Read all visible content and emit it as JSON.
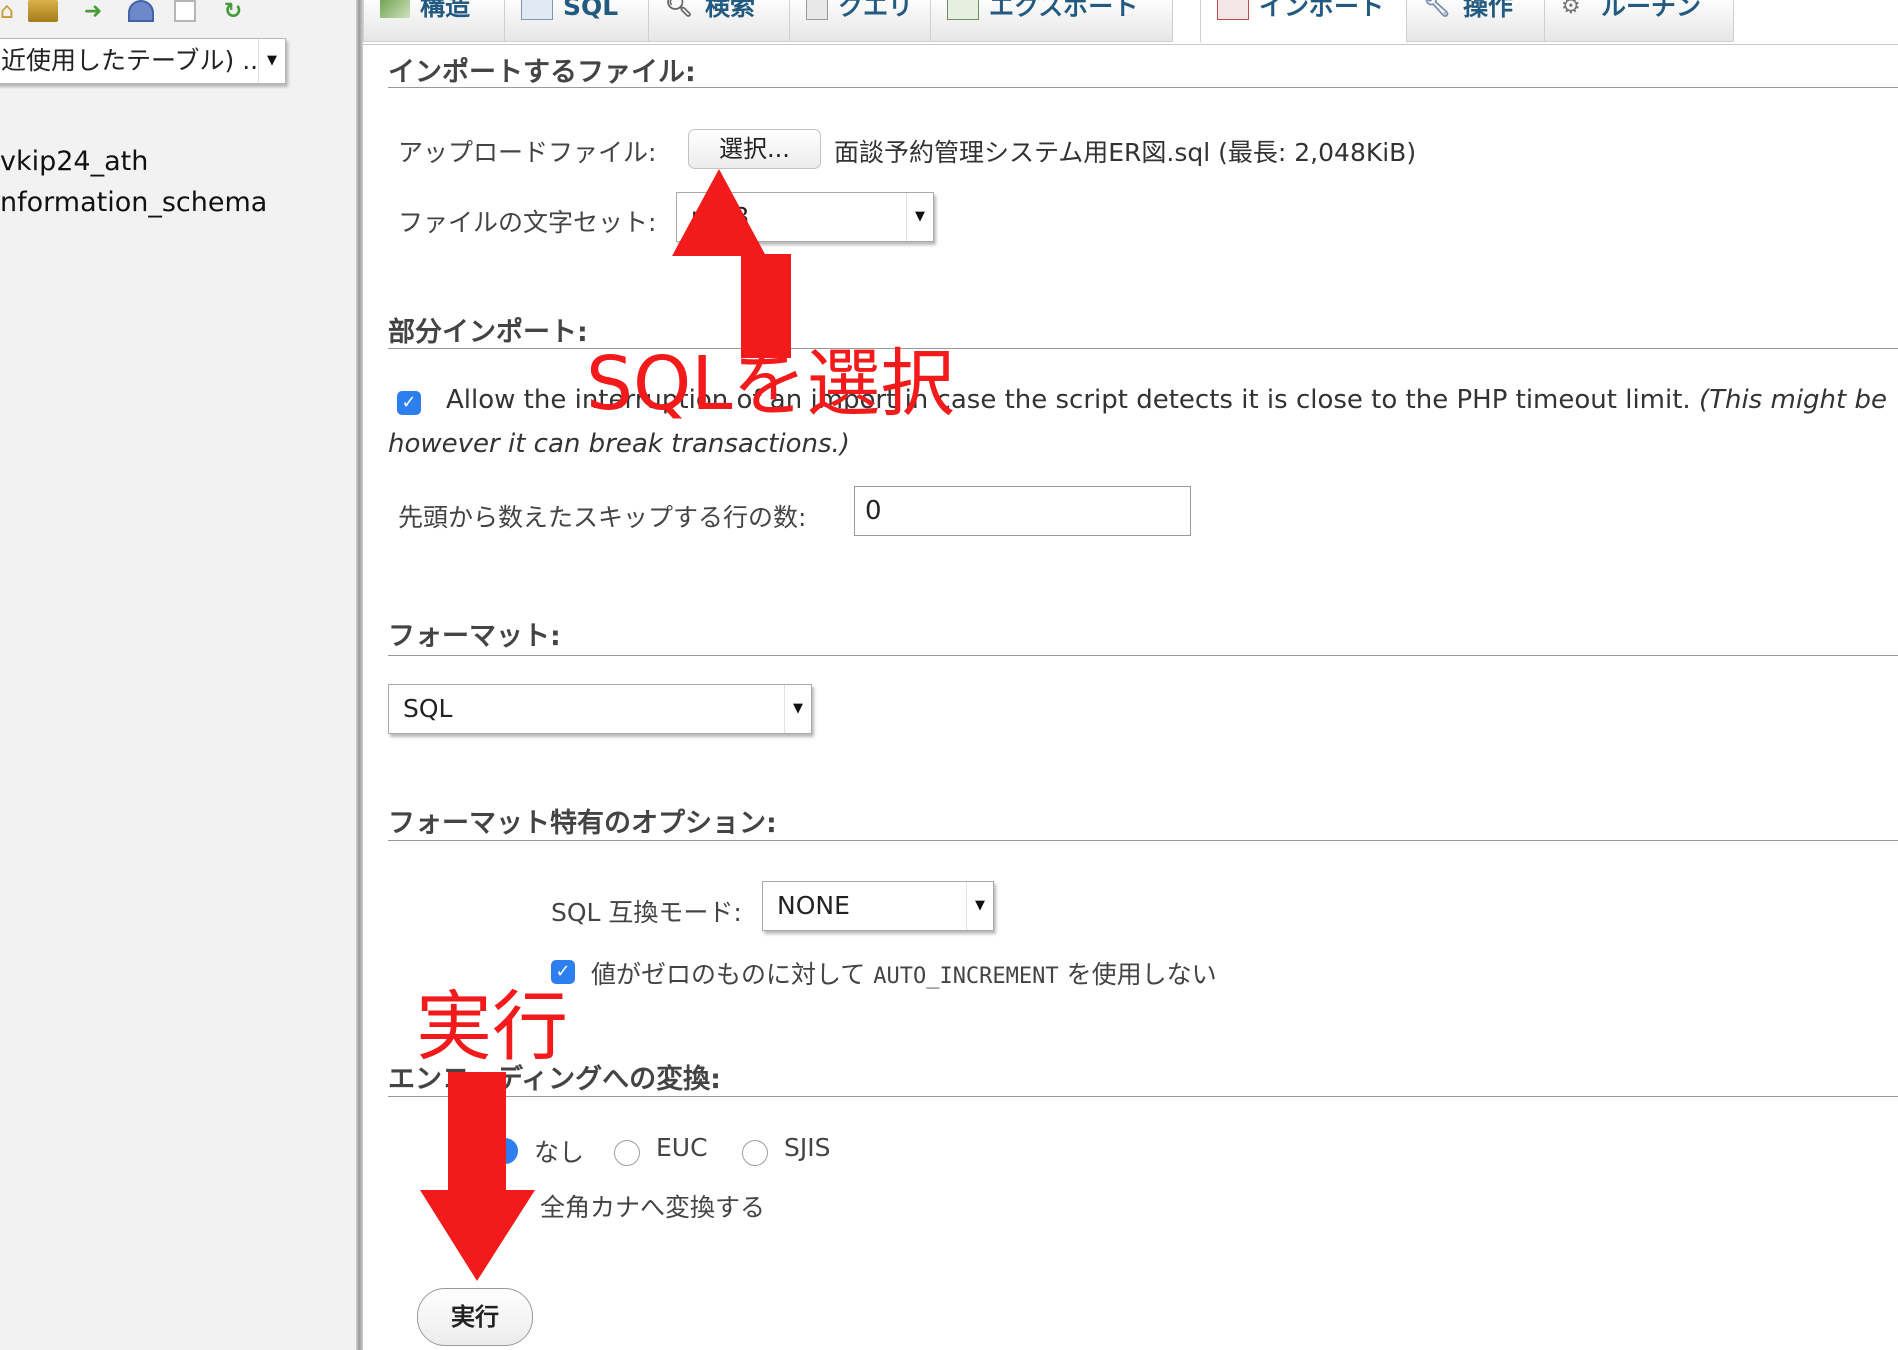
{
  "nav": {
    "recent_tables": "近使用したテーブル) ..",
    "databases": [
      "vkip24_ath",
      "nformation_schema"
    ]
  },
  "tabs": [
    {
      "label": "構造",
      "icon": "structure-icon"
    },
    {
      "label": "SQL",
      "icon": "sql-icon"
    },
    {
      "label": "検索",
      "icon": "search-icon"
    },
    {
      "label": "クエリ",
      "icon": "query-icon"
    },
    {
      "label": "エクスポート",
      "icon": "export-icon"
    },
    {
      "label": "インポート",
      "icon": "import-icon",
      "active": true
    },
    {
      "label": "操作",
      "icon": "wrench-icon"
    },
    {
      "label": "ルーチン",
      "icon": "routines-icon"
    }
  ],
  "file_section": {
    "heading": "インポートするファイル:",
    "upload_label": "アップロードファイル:",
    "choose_button": "選択...",
    "chosen_file": "面談予約管理システム用ER図.sql (最長: 2,048KiB)",
    "charset_label": "ファイルの文字セット:",
    "charset_value": "utf-8"
  },
  "partial_section": {
    "heading": "部分インポート:",
    "allow_interrupt_text": "Allow the interruption of an import in case the script detects it is close to the PHP timeout limit.",
    "allow_interrupt_note": "(This might be",
    "allow_interrupt_note2": "however it can break transactions.)",
    "skip_label": "先頭から数えたスキップする行の数:",
    "skip_value": "0"
  },
  "format_section": {
    "heading": "フォーマット:",
    "format_value": "SQL"
  },
  "options_section": {
    "heading": "フォーマット特有のオプション:",
    "compat_label": "SQL 互換モード:",
    "compat_value": "NONE",
    "auto_inc_text_1": "値がゼロのものに対して",
    "auto_inc_code": "AUTO_INCREMENT",
    "auto_inc_text_2": "を使用しない"
  },
  "encoding_section": {
    "heading": "エンコーディングへの変換:",
    "opt_none": "なし",
    "opt_euc": "EUC",
    "opt_sjis": "SJIS",
    "kana_label": "全角カナへ変換する"
  },
  "go_button": "実行",
  "annotations": {
    "select_sql": "SQLを選択",
    "execute": "実行",
    "color": "#f21a1a"
  }
}
